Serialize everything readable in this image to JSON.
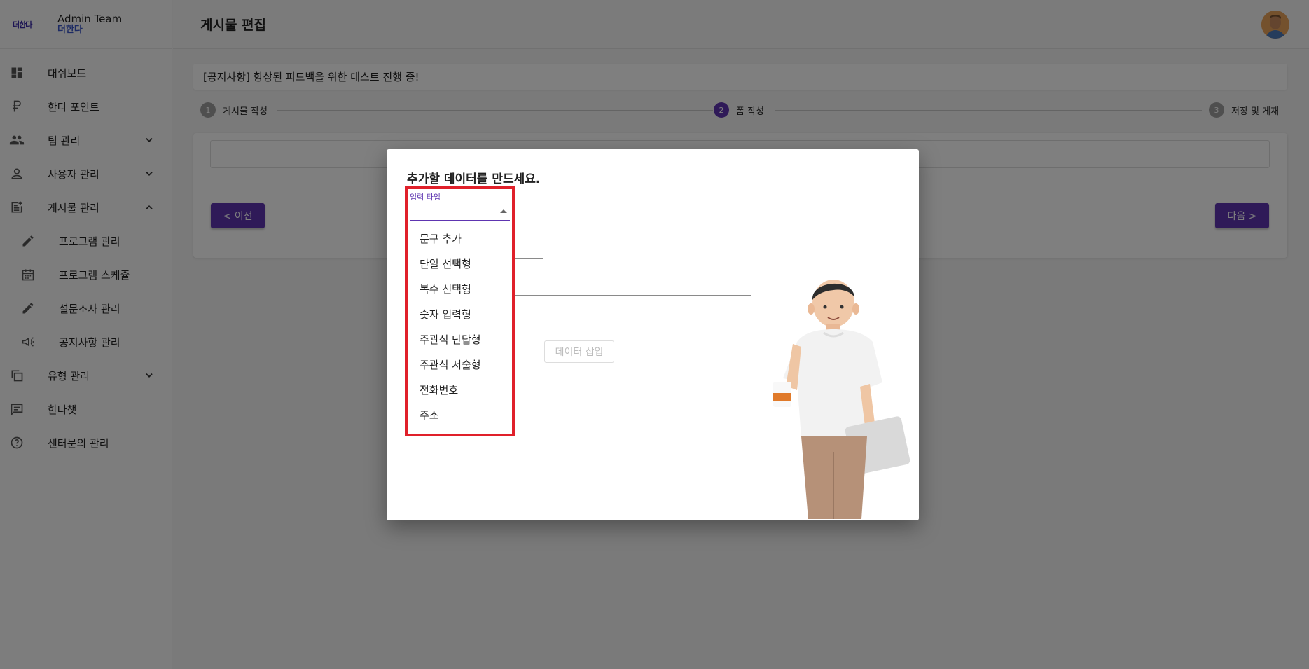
{
  "brand": {
    "logo_text": "더한다",
    "title": "Admin Team",
    "subtitle": "더한다"
  },
  "sidebar": {
    "items": [
      {
        "label": "대쉬보드",
        "icon": "dashboard-icon"
      },
      {
        "label": "한다 포인트",
        "icon": "ruble-icon"
      },
      {
        "label": "팀 관리",
        "icon": "group-icon",
        "chevron": "down"
      },
      {
        "label": "사용자 관리",
        "icon": "person-icon",
        "chevron": "down"
      },
      {
        "label": "게시물 관리",
        "icon": "post-add-icon",
        "chevron": "up"
      },
      {
        "label": "프로그램 관리",
        "icon": "pencil-icon",
        "sub": true
      },
      {
        "label": "프로그램 스케쥴",
        "icon": "calendar-icon",
        "sub": true
      },
      {
        "label": "설문조사 관리",
        "icon": "pencil-icon",
        "sub": true
      },
      {
        "label": "공지사항 관리",
        "icon": "megaphone-icon",
        "sub": true
      },
      {
        "label": "유형 관리",
        "icon": "copy-icon",
        "chevron": "down"
      },
      {
        "label": "한다챗",
        "icon": "chat-icon"
      },
      {
        "label": "센터문의 관리",
        "icon": "help-icon"
      }
    ]
  },
  "header": {
    "title": "게시물 편집"
  },
  "notice": {
    "text": "[공지사항] 향상된 피드백을 위한 테스트 진행 중!"
  },
  "stepper": {
    "steps": [
      {
        "num": "1",
        "label": "게시물 작성"
      },
      {
        "num": "2",
        "label": "폼 작성"
      },
      {
        "num": "3",
        "label": "저장 및 게재"
      }
    ]
  },
  "nav_buttons": {
    "prev": "< 이전",
    "next": "다음 >"
  },
  "modal": {
    "title": "추가할 데이터를 만드세요.",
    "insert_label": "데이터 삽입",
    "input_type": {
      "label": "입력 타입",
      "options": [
        "문구 추가",
        "단일 선택형",
        "복수 선택형",
        "숫자 입력형",
        "주관식 단답형",
        "주관식 서술형",
        "전화번호",
        "주소"
      ]
    }
  },
  "colors": {
    "accent": "#5e35b1",
    "highlight": "#e0202a"
  }
}
